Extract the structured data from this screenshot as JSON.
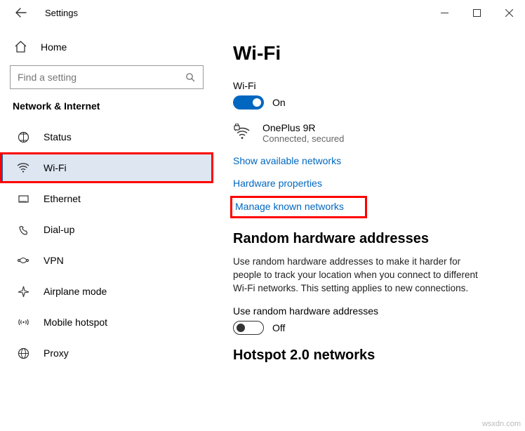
{
  "window": {
    "title": "Settings"
  },
  "sidebar": {
    "home": "Home",
    "search_placeholder": "Find a setting",
    "section": "Network & Internet",
    "items": [
      {
        "label": "Status"
      },
      {
        "label": "Wi-Fi"
      },
      {
        "label": "Ethernet"
      },
      {
        "label": "Dial-up"
      },
      {
        "label": "VPN"
      },
      {
        "label": "Airplane mode"
      },
      {
        "label": "Mobile hotspot"
      },
      {
        "label": "Proxy"
      }
    ]
  },
  "page": {
    "title": "Wi-Fi",
    "wifi_label": "Wi-Fi",
    "wifi_toggle_state": "On",
    "current_network": {
      "name": "OnePlus 9R",
      "status": "Connected, secured"
    },
    "links": {
      "show_available": "Show available networks",
      "hardware_props": "Hardware properties",
      "manage_known": "Manage known networks"
    },
    "random_hw": {
      "title": "Random hardware addresses",
      "desc": "Use random hardware addresses to make it harder for people to track your location when you connect to different Wi-Fi networks. This setting applies to new connections.",
      "toggle_label": "Use random hardware addresses",
      "toggle_state": "Off"
    },
    "hotspot_title": "Hotspot 2.0 networks"
  },
  "watermark": "wsxdn.com"
}
